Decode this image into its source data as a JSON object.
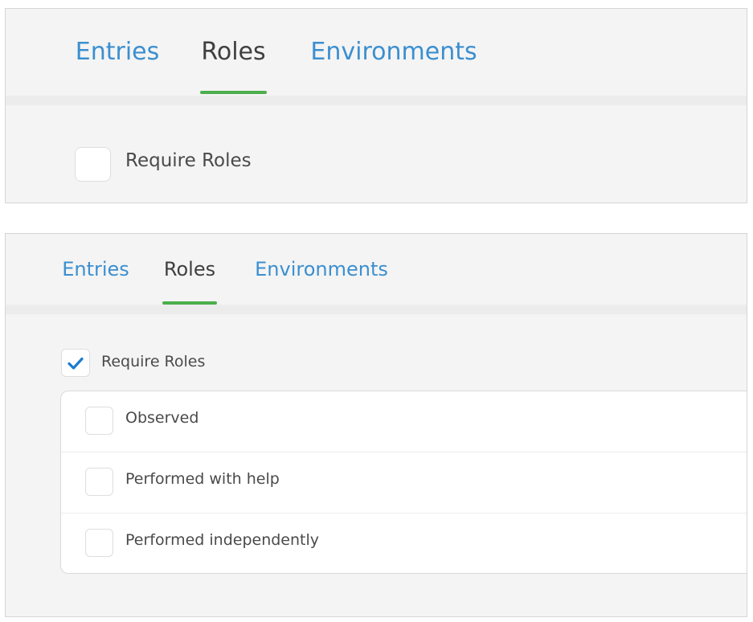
{
  "panel_collapsed": {
    "tabs": [
      {
        "label": "Entries",
        "active": false
      },
      {
        "label": "Roles",
        "active": true
      },
      {
        "label": "Environments",
        "active": false
      }
    ],
    "require_roles": {
      "label": "Require Roles",
      "checked": false
    }
  },
  "panel_expanded": {
    "tabs": [
      {
        "label": "Entries",
        "active": false
      },
      {
        "label": "Roles",
        "active": true
      },
      {
        "label": "Environments",
        "active": false
      }
    ],
    "require_roles": {
      "label": "Require Roles",
      "checked": true
    },
    "roles": [
      {
        "label": "Observed",
        "checked": false
      },
      {
        "label": "Performed with help",
        "checked": false
      },
      {
        "label": "Performed independently",
        "checked": false
      }
    ]
  },
  "colors": {
    "tab_link": "#3b8fd0",
    "tab_active": "#3f3f3f",
    "tab_underline": "#4cae4c",
    "check_mark": "#1a7bd0"
  },
  "icons": {
    "check": "check-icon"
  }
}
